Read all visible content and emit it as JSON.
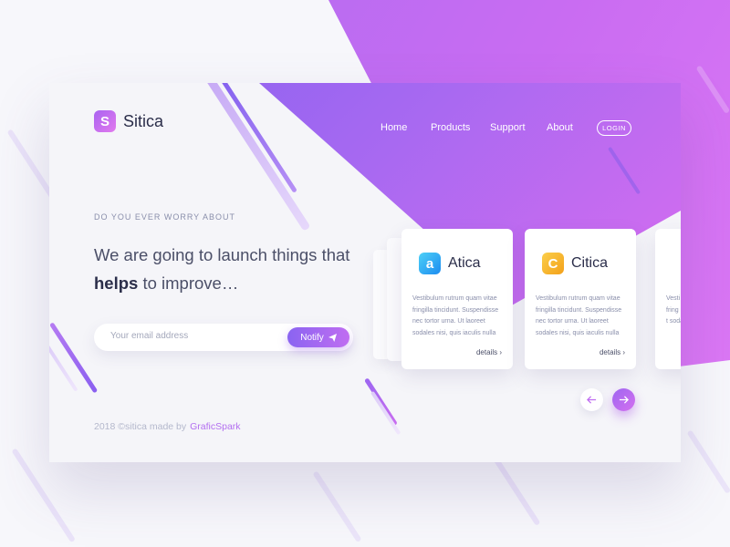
{
  "brand": {
    "name": "Sitica",
    "logo_letter": "S"
  },
  "nav": {
    "items": [
      "Home",
      "Products",
      "Support",
      "About"
    ],
    "login_label": "LOGIN"
  },
  "hero": {
    "eyebrow": "DO YOU EVER WORRY ABOUT",
    "headline_pre": "We are going to launch things that ",
    "headline_bold": "helps",
    "headline_post": " to improve…",
    "email_placeholder": "Your email address",
    "notify_label": "Notify"
  },
  "footer": {
    "text": "2018 ©sitica made by",
    "brand": "GraficSpark"
  },
  "products": [
    {
      "name": "Atica",
      "letter": "a",
      "icon_color": "#28a8f0",
      "description": "Vestibulum rutrum quam vitae fringilla tincidunt. Suspendisse nec tortor urna. Ut laoreet sodales nisi, quis iaculis nulla",
      "details_label": "details"
    },
    {
      "name": "Citica",
      "letter": "C",
      "icon_color": "#f6b321",
      "description": "Vestibulum rutrum quam vitae fringilla tincidunt. Suspendisse nec tortor urna. Ut laoreet sodales nisi, quis iaculis nulla",
      "details_label": "details"
    },
    {
      "name": "",
      "letter": "",
      "icon_color": "",
      "description": "Vesti fring nec t soda",
      "details_label": ""
    }
  ],
  "carousel": {
    "prev_icon": "arrow-left-icon",
    "next_icon": "arrow-right-icon"
  },
  "colors": {
    "accent": "#a963f1",
    "accent2": "#e27aee",
    "text": "#2b2e4a",
    "muted": "#8a8fab"
  }
}
